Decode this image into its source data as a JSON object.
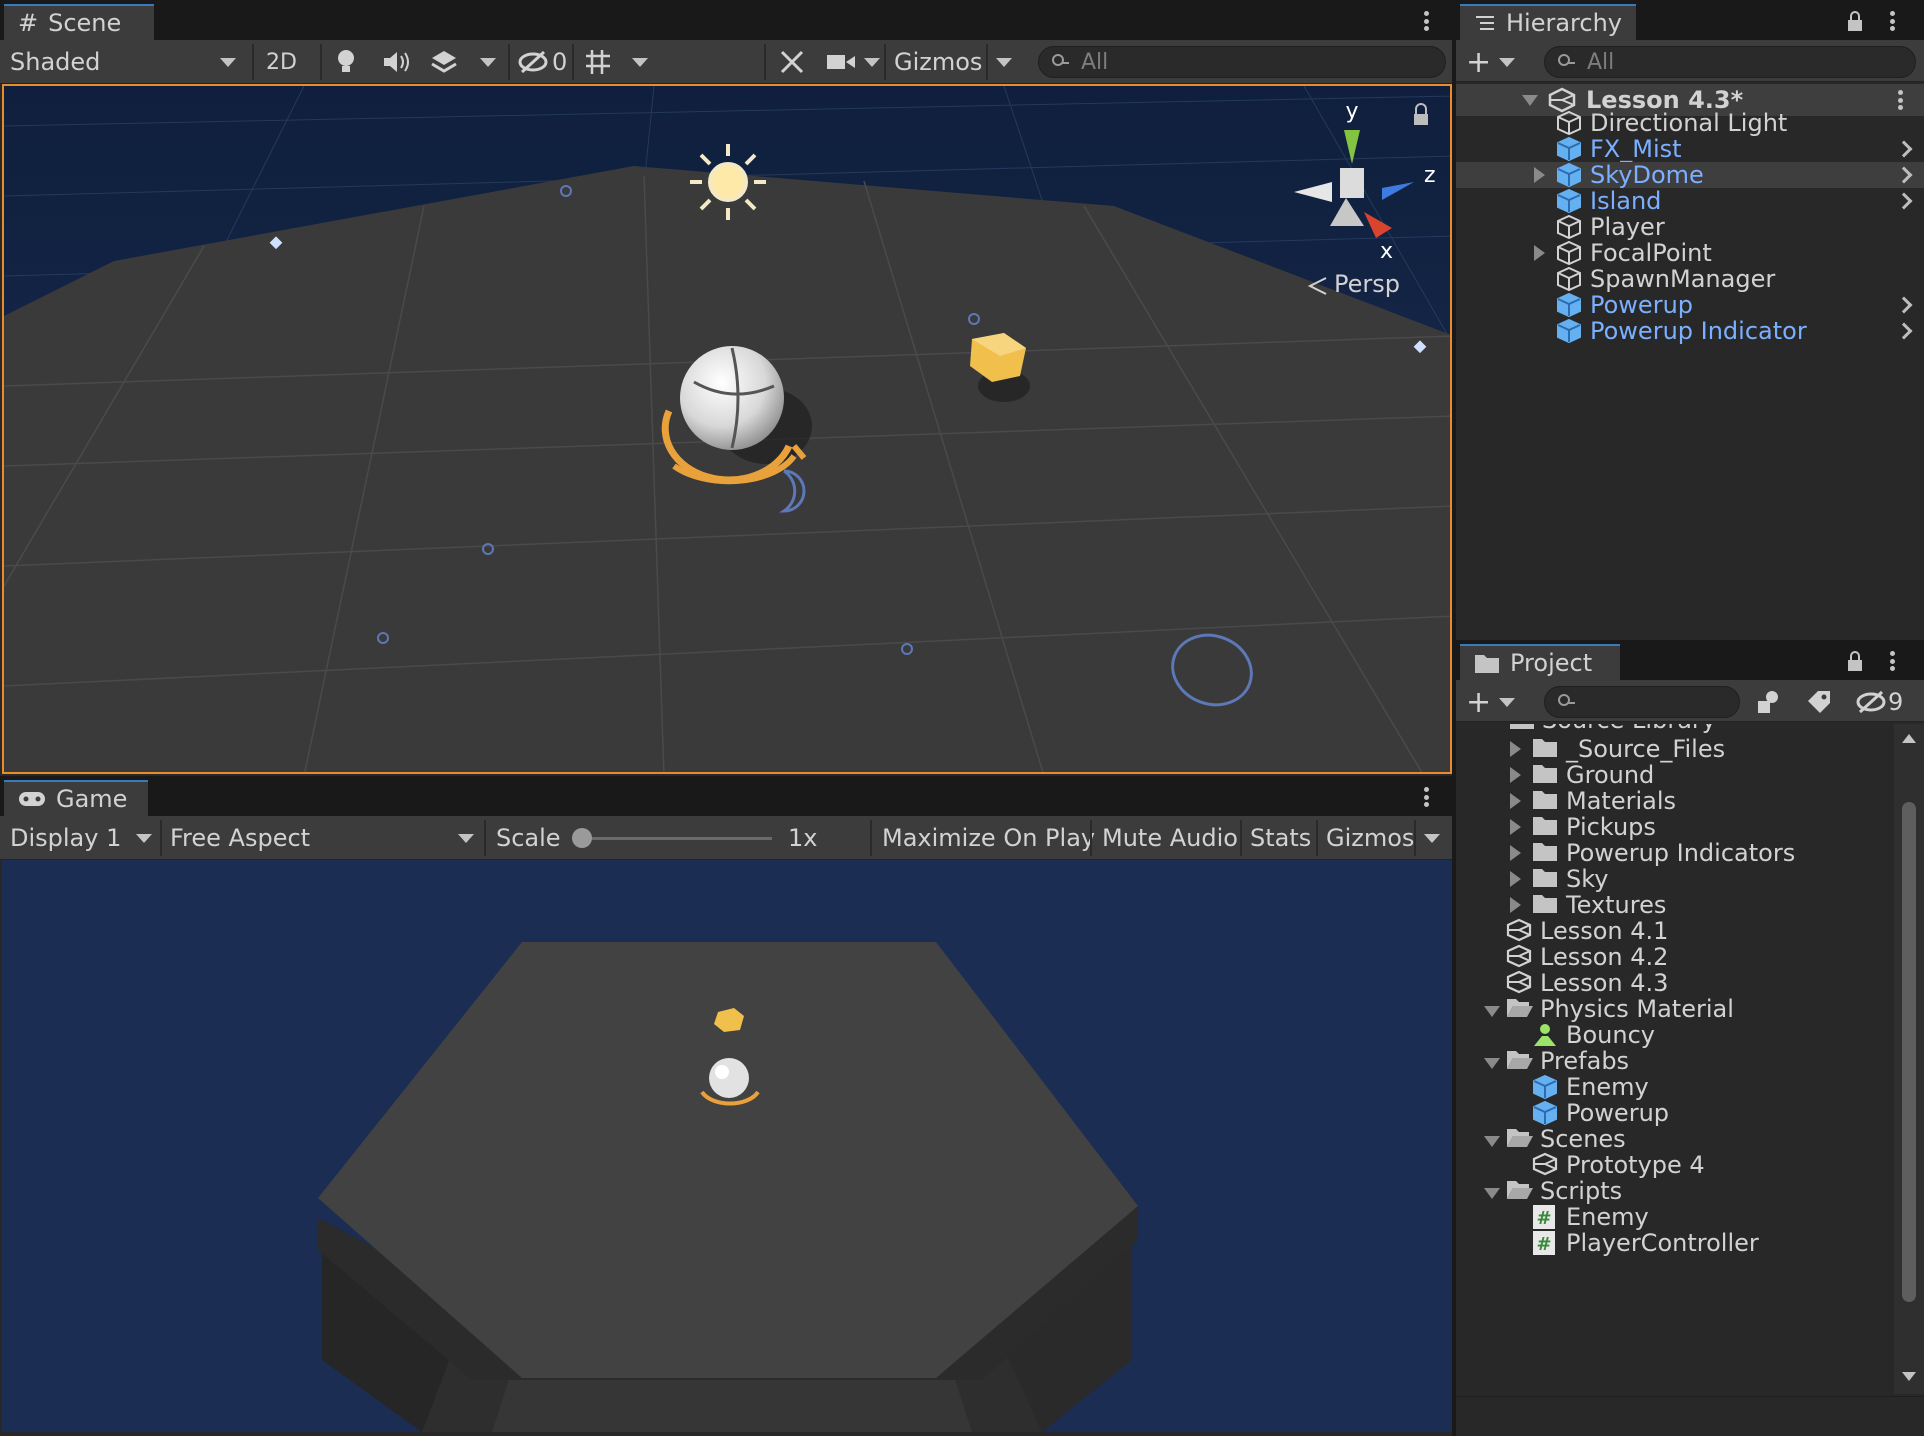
{
  "scene": {
    "tab_label": "Scene",
    "shading_mode": "Shaded",
    "mode_2d": "2D",
    "hidden_count": "0",
    "gizmos_label": "Gizmos",
    "search_placeholder": "All",
    "persp_label": "Persp",
    "axis_y": "y",
    "axis_z": "z",
    "axis_x": "x"
  },
  "hierarchy": {
    "tab_label": "Hierarchy",
    "search_placeholder": "All",
    "scene_name": "Lesson 4.3*",
    "items": [
      {
        "label": "Directional Light",
        "prefab": false,
        "expandable": false,
        "chevron": false
      },
      {
        "label": "FX_Mist",
        "prefab": true,
        "expandable": false,
        "chevron": true
      },
      {
        "label": "SkyDome",
        "prefab": true,
        "expandable": true,
        "chevron": true,
        "selected": true
      },
      {
        "label": "Island",
        "prefab": true,
        "expandable": false,
        "chevron": true
      },
      {
        "label": "Player",
        "prefab": false,
        "expandable": false,
        "chevron": false
      },
      {
        "label": "FocalPoint",
        "prefab": false,
        "expandable": true,
        "chevron": false
      },
      {
        "label": "SpawnManager",
        "prefab": false,
        "expandable": false,
        "chevron": false
      },
      {
        "label": "Powerup",
        "prefab": true,
        "expandable": false,
        "chevron": true
      },
      {
        "label": "Powerup Indicator",
        "prefab": true,
        "expandable": false,
        "chevron": true
      }
    ]
  },
  "project": {
    "tab_label": "Project",
    "hidden_count": "9",
    "cut_off_label": "Source Library",
    "items": [
      {
        "label": "_Source_Files",
        "icon": "folder",
        "indent": 2,
        "arrow": "right"
      },
      {
        "label": "Ground",
        "icon": "folder",
        "indent": 2,
        "arrow": "right"
      },
      {
        "label": "Materials",
        "icon": "folder",
        "indent": 2,
        "arrow": "right"
      },
      {
        "label": "Pickups",
        "icon": "folder",
        "indent": 2,
        "arrow": "right"
      },
      {
        "label": "Powerup Indicators",
        "icon": "folder",
        "indent": 2,
        "arrow": "right"
      },
      {
        "label": "Sky",
        "icon": "folder",
        "indent": 2,
        "arrow": "right"
      },
      {
        "label": "Textures",
        "icon": "folder",
        "indent": 2,
        "arrow": "right"
      },
      {
        "label": "Lesson 4.1",
        "icon": "unity",
        "indent": 1,
        "arrow": "none"
      },
      {
        "label": "Lesson 4.2",
        "icon": "unity",
        "indent": 1,
        "arrow": "none"
      },
      {
        "label": "Lesson 4.3",
        "icon": "unity",
        "indent": 1,
        "arrow": "none"
      },
      {
        "label": "Physics Material",
        "icon": "folder-open",
        "indent": 1,
        "arrow": "down"
      },
      {
        "label": "Bouncy",
        "icon": "physics",
        "indent": 2,
        "arrow": "none"
      },
      {
        "label": "Prefabs",
        "icon": "folder-open",
        "indent": 1,
        "arrow": "down"
      },
      {
        "label": "Enemy",
        "icon": "prefab",
        "indent": 2,
        "arrow": "none"
      },
      {
        "label": "Powerup",
        "icon": "prefab",
        "indent": 2,
        "arrow": "none"
      },
      {
        "label": "Scenes",
        "icon": "folder-open",
        "indent": 1,
        "arrow": "down"
      },
      {
        "label": "Prototype 4",
        "icon": "unity",
        "indent": 2,
        "arrow": "none"
      },
      {
        "label": "Scripts",
        "icon": "folder-open",
        "indent": 1,
        "arrow": "down"
      },
      {
        "label": "Enemy",
        "icon": "script",
        "indent": 2,
        "arrow": "none"
      },
      {
        "label": "PlayerController",
        "icon": "script",
        "indent": 2,
        "arrow": "none"
      }
    ]
  },
  "game": {
    "tab_label": "Game",
    "display": "Display 1",
    "aspect": "Free Aspect",
    "scale_label": "Scale",
    "scale_value": "1x",
    "maximize_label": "Maximize On Play",
    "mute_label": "Mute Audio",
    "stats_label": "Stats",
    "gizmos_label": "Gizmos"
  },
  "colors": {
    "accent": "#3a79bb",
    "viewport_border": "#e98d2c",
    "prefab_blue": "#7bafff",
    "sky_dark": "#1b2d52"
  }
}
